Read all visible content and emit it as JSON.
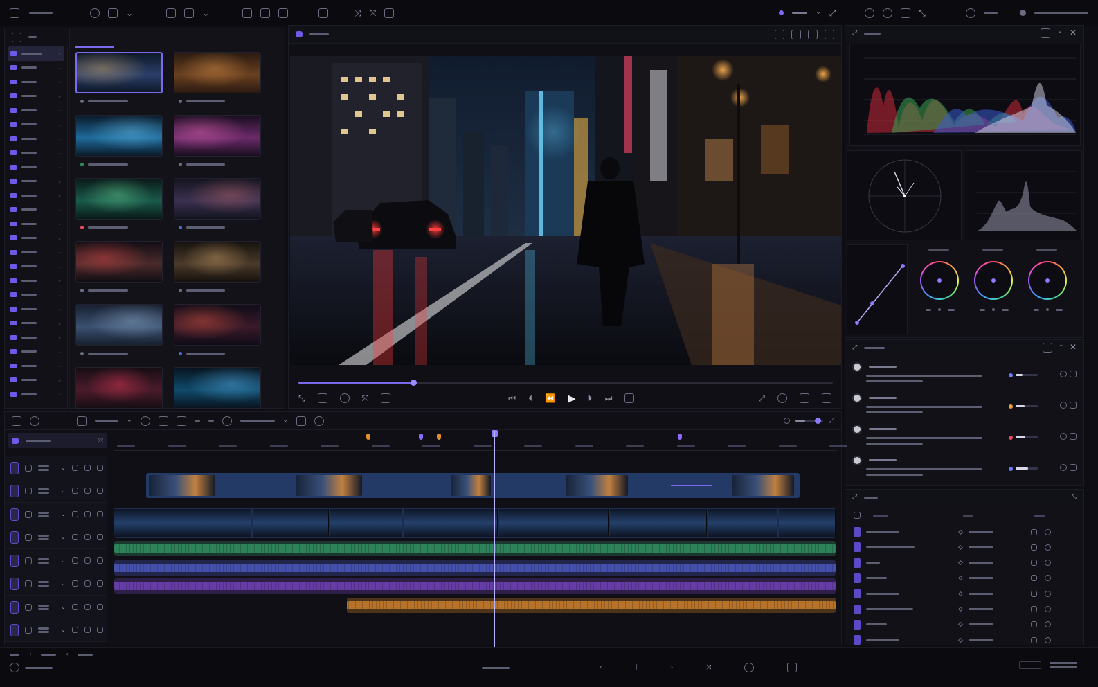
{
  "colors": {
    "accent": "#7b6af0",
    "background": "#0d0d13",
    "video_track": "#233a66",
    "audio_green": "#2f8a5e",
    "audio_blue": "#4a55b8",
    "audio_purple": "#6b3fb0",
    "audio_orange": "#c27a2a",
    "marker_orange": "#e0902a",
    "marker_purple": "#8b6bff",
    "red_dot": "#e84a5a",
    "orange_dot": "#f0a030",
    "blue_dot": "#6c7cff"
  },
  "topbar": {
    "icons": [
      "app-icon",
      "undo-icon",
      "save-icon",
      "dropdown-icon",
      "import-icon",
      "export-icon",
      "dropdown-icon",
      "cut-icon",
      "copy-icon",
      "paste-icon",
      "lock-icon",
      "split-icon",
      "link-icon",
      "grid-icon"
    ],
    "right_icons": [
      "record-icon",
      "sync-icon",
      "refresh-icon",
      "layout-icon",
      "expand-icon",
      "info-icon",
      "user-icon"
    ]
  },
  "folder_tree": {
    "count": 25,
    "active_index": 0
  },
  "media_bin": {
    "thumbnail_count": 12,
    "selected_index": 0,
    "status_dots": [
      "#6b6c80",
      "#6b6c80",
      "#2f8a5e",
      "#6b6c80",
      "#e84a5a",
      "#4a6cd0",
      "#6b6c80",
      "#6b6c80",
      "#6b6c80",
      "#4a6cd0",
      "#6b6c80",
      "#6b6c80"
    ]
  },
  "viewer": {
    "progress": 0.215
  },
  "scopes": {
    "wheel_count": 3
  },
  "inspector": {
    "rows": [
      {
        "dot_color": "#6c7cff",
        "level": 0.3
      },
      {
        "dot_color": "#f0a030",
        "level": 0.4
      },
      {
        "dot_color": "#e84a5a",
        "level": 0.45
      },
      {
        "dot_color": "#6c7cff",
        "level": 0.55
      }
    ]
  },
  "layers": {
    "count": 8
  },
  "timeline": {
    "track_count": 8,
    "playhead_fraction": 0.523
  }
}
